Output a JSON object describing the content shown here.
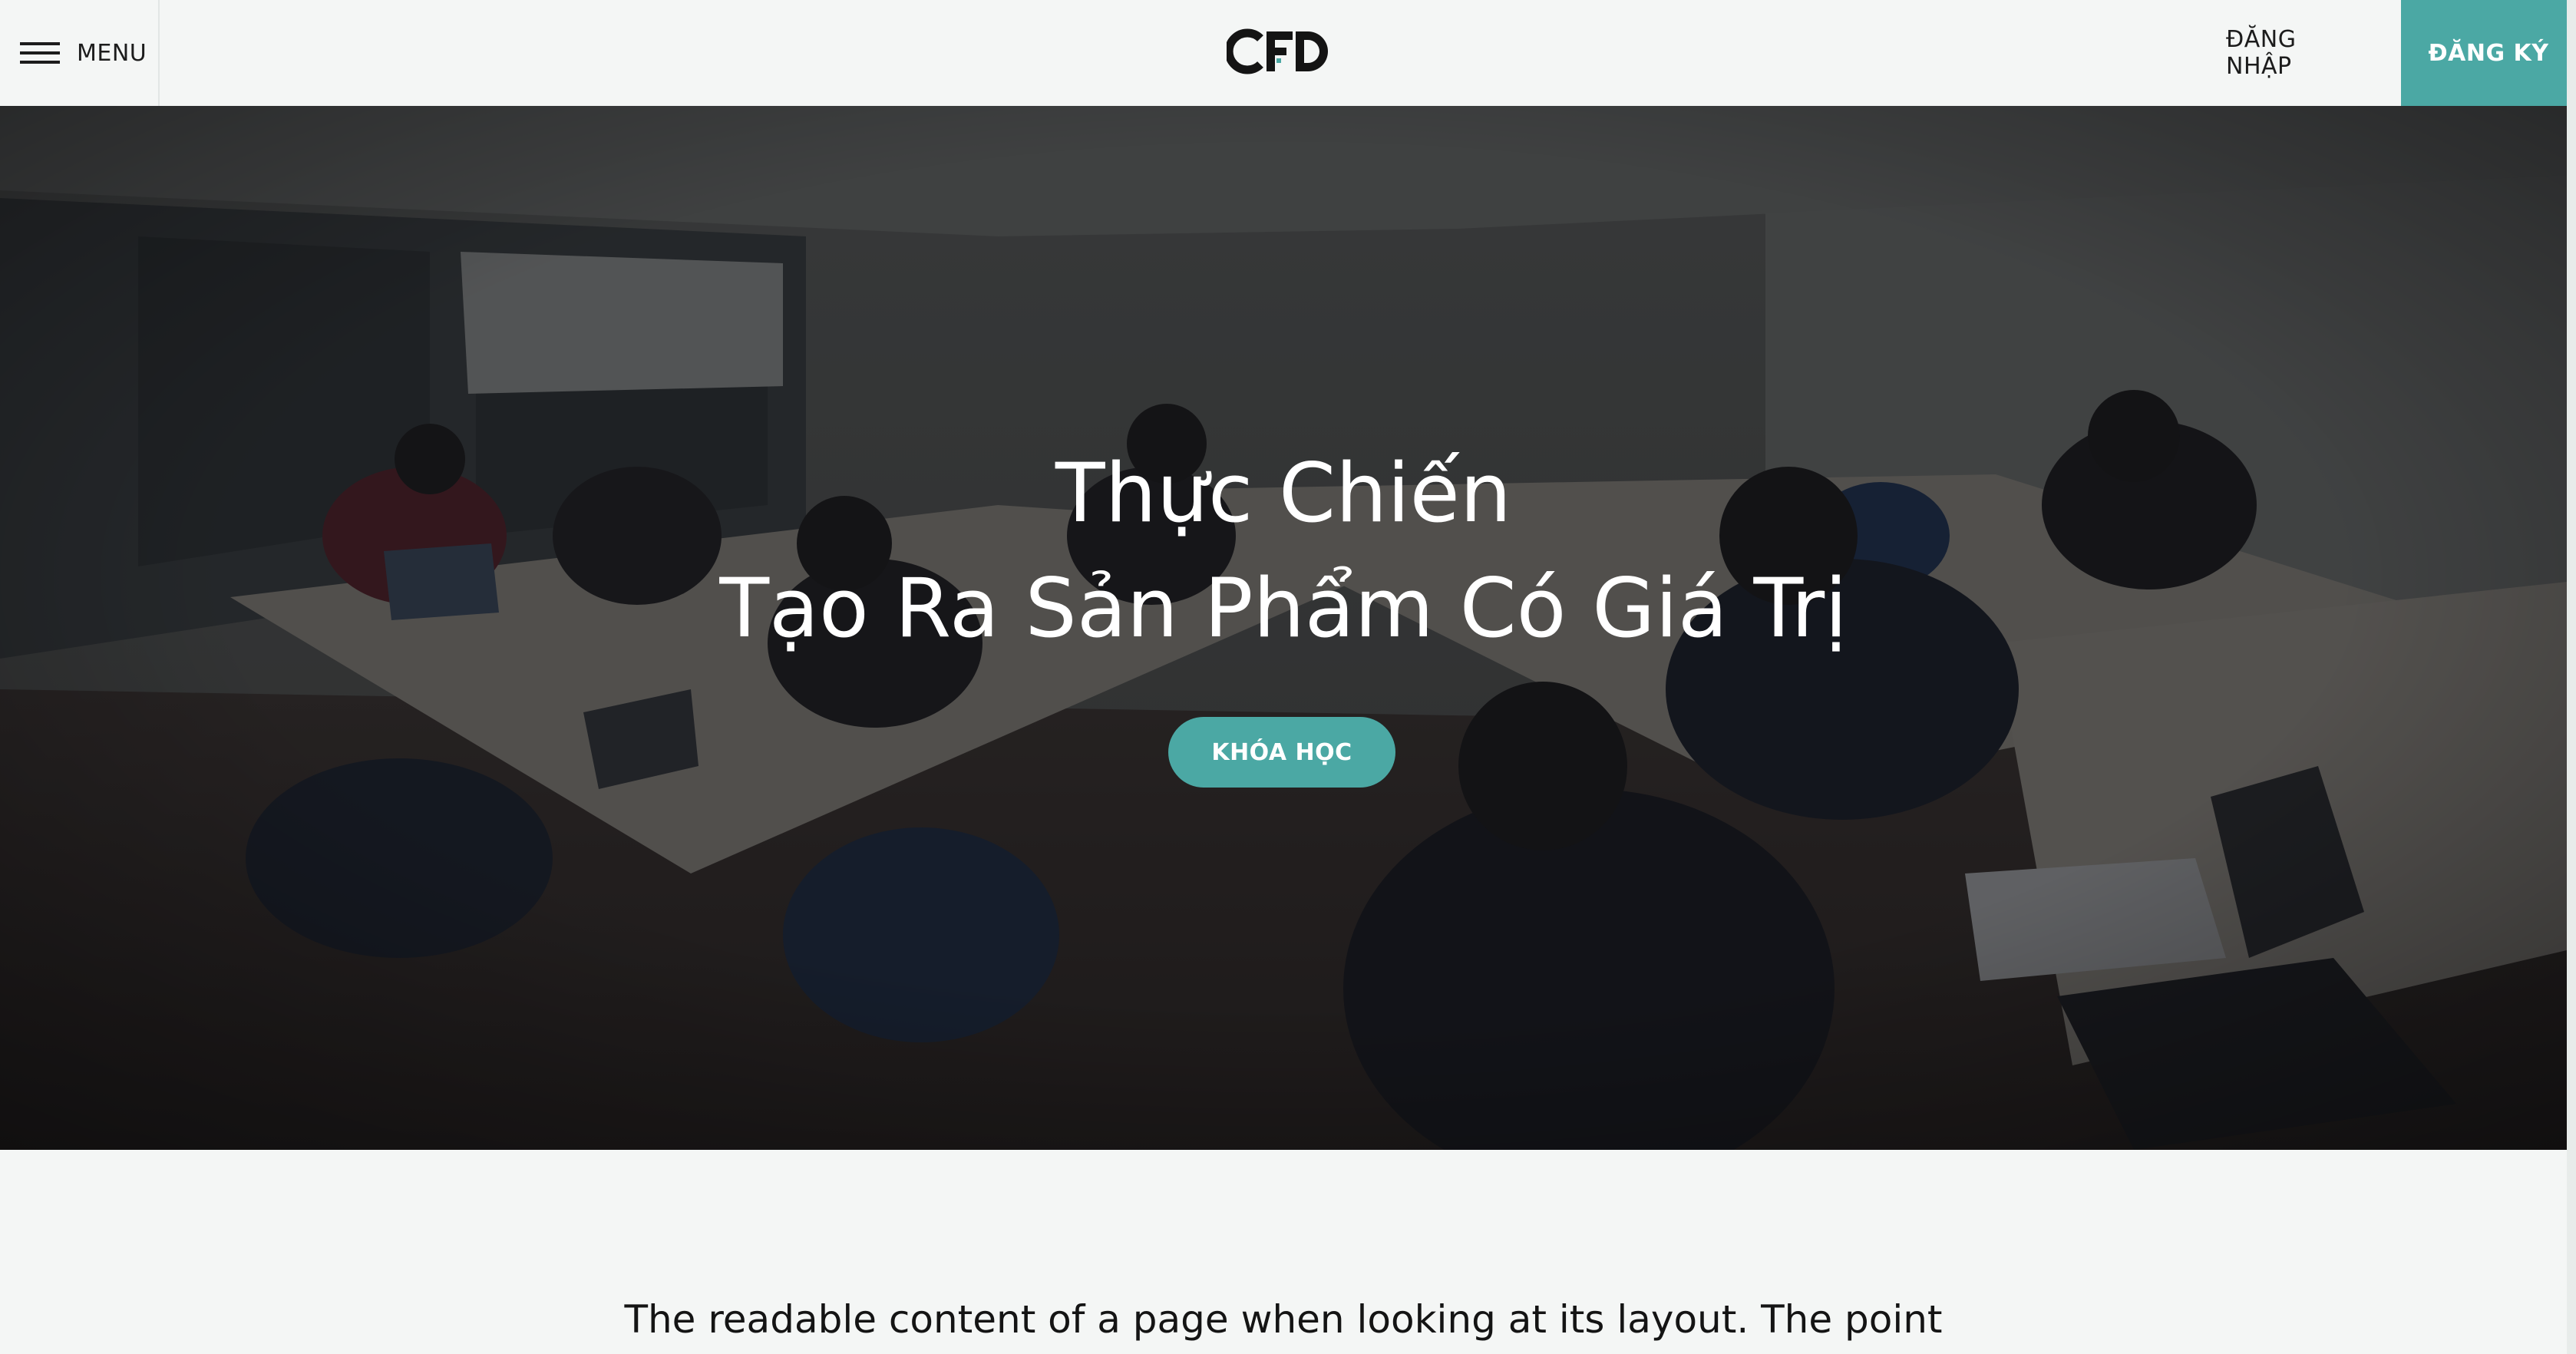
{
  "header": {
    "menu_label": "MENU",
    "logo_text": "CFD",
    "login_label": "ĐĂNG NHẬP",
    "register_label": "ĐĂNG KÝ"
  },
  "hero": {
    "title_line1": "Thực Chiến",
    "title_line2": "Tạo Ra Sản Phẩm Có Giá Trị",
    "cta_label": "KHÓA HỌC"
  },
  "intro": {
    "text": "The readable content of a page when looking at its layout. The point"
  },
  "colors": {
    "accent": "#4ba8a4",
    "background": "#f4f6f5",
    "text": "#1c1c1c"
  },
  "icons": {
    "menu": "hamburger-icon",
    "logo": "cfd-logo"
  }
}
